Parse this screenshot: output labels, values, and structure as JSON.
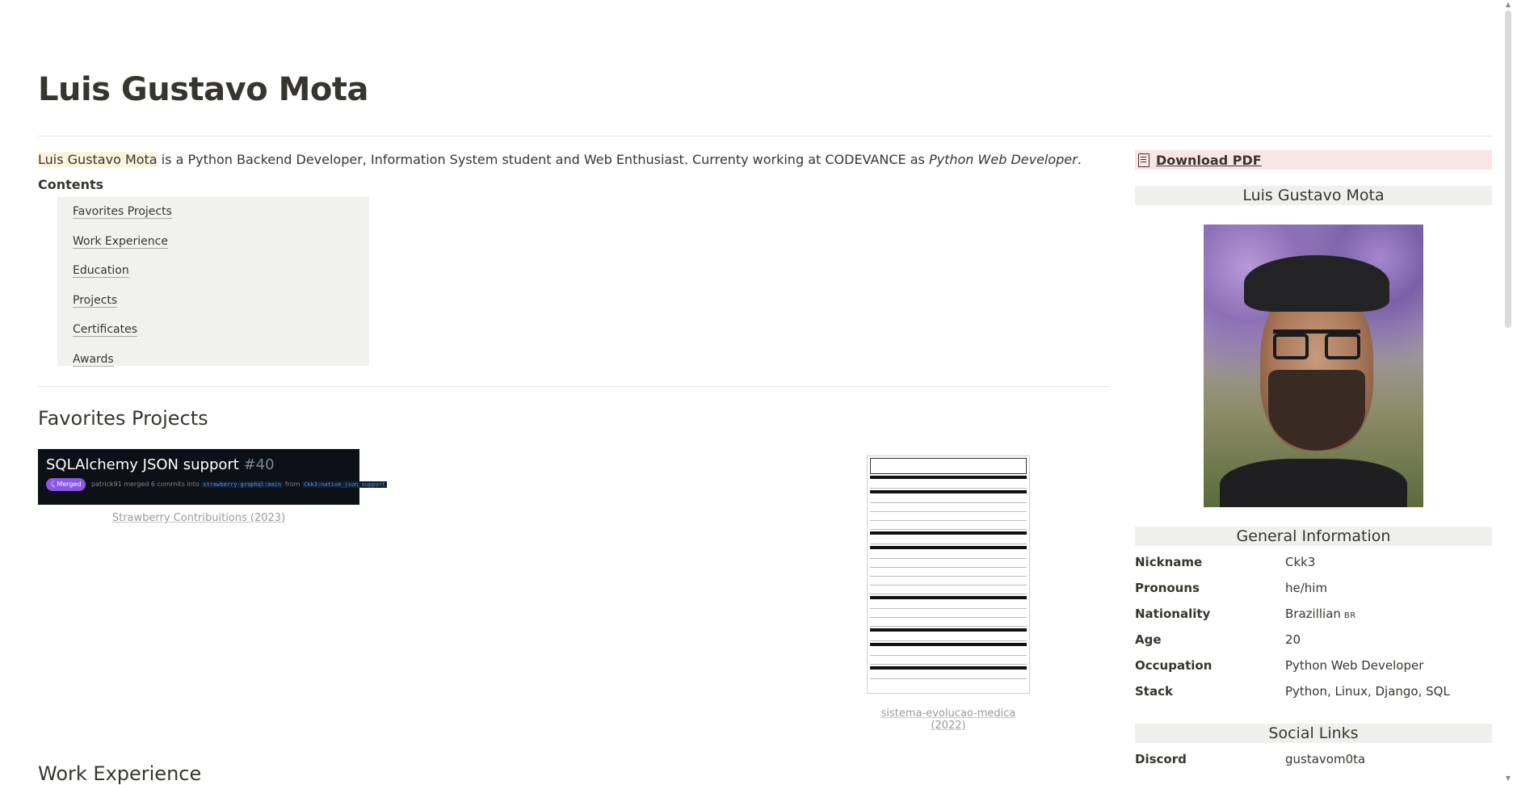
{
  "page": {
    "title": "Luis Gustavo Mota"
  },
  "intro": {
    "name_highlight": "Luis Gustavo Mota",
    "text_before_role": " is a Python Backend Developer, Information System student and Web Enthusiast. Currenty working at CODEVANCE as ",
    "role": "Python Web Developer",
    "text_after": "."
  },
  "contents": {
    "label": "Contents",
    "items": [
      "Favorites Projects",
      "Work Experience",
      "Education",
      "Projects",
      "Certificates",
      "Awards"
    ]
  },
  "favorites": {
    "heading": "Favorites Projects",
    "card1": {
      "title": "SQLAlchemy JSON support",
      "number": "#40",
      "badge": "Merged",
      "meta_text": "patrick91 merged 6 commits into",
      "target_branch": "strawberry-graphql:main",
      "from_text": "from",
      "source_branch": "Ckk3:native_json_support",
      "caption": "Strawberry Contribuitions (2023)"
    },
    "card2": {
      "caption": "sistema-evolucao-medica (2022)"
    }
  },
  "work": {
    "heading": "Work Experience"
  },
  "sidebar": {
    "download_label": "Download PDF",
    "name_header": "Luis Gustavo Mota",
    "general_header": "General Information",
    "info": [
      {
        "key": "Nickname",
        "value": "Ckk3"
      },
      {
        "key": "Pronouns",
        "value": "he/him"
      },
      {
        "key": "Nationality",
        "value": "Brazillian",
        "flag": "BR"
      },
      {
        "key": "Age",
        "value": "20"
      },
      {
        "key": "Occupation",
        "value": "Python Web Developer"
      },
      {
        "key": "Stack",
        "value": "Python, Linux, Django, SQL"
      }
    ],
    "social_header": "Social Links",
    "social": [
      {
        "key": "Discord",
        "value": "gustavom0ta"
      }
    ]
  },
  "icons": {
    "download": "document-icon",
    "merged": "merge-icon"
  },
  "colors": {
    "text": "#37352f",
    "highlight": "#fbf3db",
    "download_bg": "#fbe4e4",
    "header_bg": "#efefed",
    "toc_bg": "#f1f1ef",
    "merged_badge": "#8957e5",
    "github_bg": "#0d1117"
  }
}
